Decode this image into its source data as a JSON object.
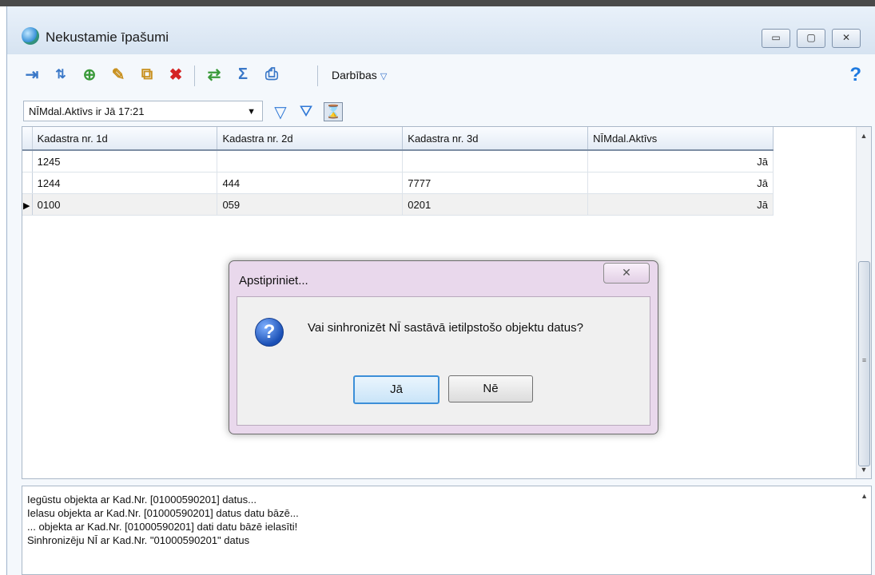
{
  "window": {
    "title": "Nekustamie īpašumi",
    "minimize": "▭",
    "maximize": "▢",
    "close": "✕"
  },
  "toolbar": {
    "actions_label": "Darbības",
    "actions_arrow": "▽",
    "help": "?",
    "icons": [
      "import-icon",
      "sort-icon",
      "new-record-icon",
      "edit-icon",
      "copy-icon",
      "delete-icon",
      "refresh-icon",
      "sum-icon",
      "print-icon"
    ]
  },
  "filter": {
    "value": "NĪMdal.Aktīvs ir Jā 17:21",
    "dropdown": "▼"
  },
  "grid": {
    "columns": [
      "Kadastra nr. 1d",
      "Kadastra nr. 2d",
      "Kadastra nr. 3d",
      "NĪMdal.Aktīvs"
    ],
    "rows": [
      [
        "1245",
        "",
        "",
        "Jā"
      ],
      [
        "1244",
        "444",
        "7777",
        "Jā"
      ],
      [
        "0100",
        "059",
        "0201",
        "Jā"
      ]
    ],
    "current_row_marker": "▶"
  },
  "dialog": {
    "title": "Apstipriniet...",
    "close": "✕",
    "message": "Vai sinhronizēt NĪ sastāvā ietilpstošo objektu datus?",
    "icon": "?",
    "yes": "Jā",
    "no": "Nē"
  },
  "log": {
    "lines": [
      "Iegūstu objekta ar Kad.Nr. [01000590201] datus...",
      "Ielasu objekta ar Kad.Nr. [01000590201] datus datu bāzē...",
      "... objekta ar Kad.Nr. [01000590201] dati datu bāzē ielasīti!",
      "Sinhronizēju NĪ ar Kad.Nr. \"01000590201\" datus"
    ]
  }
}
